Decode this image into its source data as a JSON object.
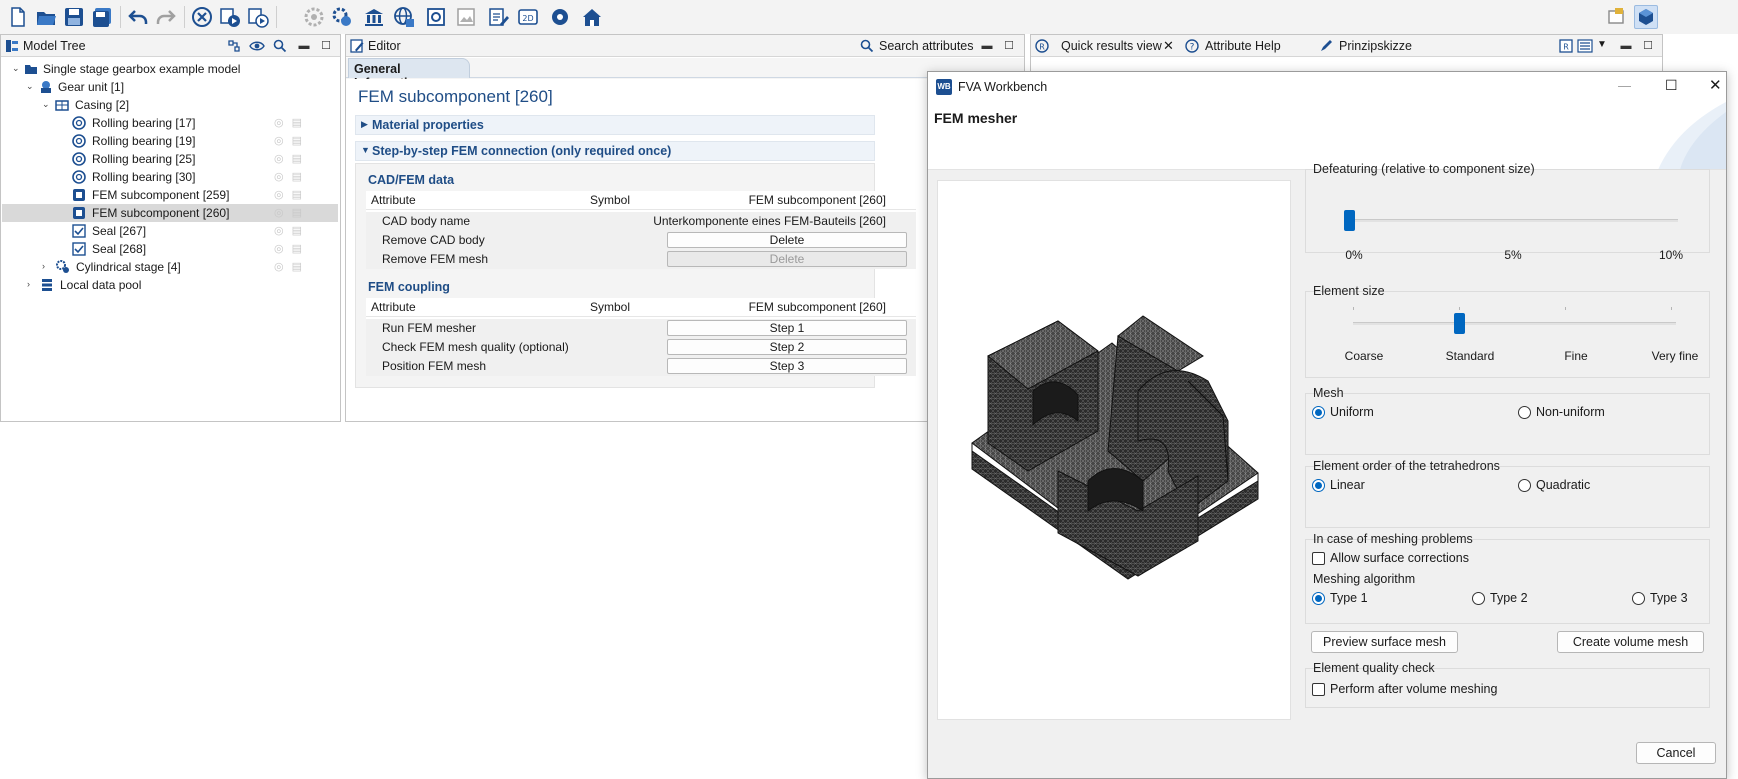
{
  "colors": {
    "accent": "#0067c0",
    "section_text": "#1f4d86",
    "pane_header": "#f3f3f3",
    "selected_row": "#d9d9d9"
  },
  "toolbar": {
    "icons": [
      "new-document-icon",
      "open-folder-icon",
      "save-icon",
      "save-all-icon",
      "undo-icon",
      "redo-icon",
      "stop-calculation-icon",
      "run-calculation-icon",
      "run-step-icon",
      "gear-disabled-icon",
      "gear-settings-icon",
      "library-icon",
      "globe-icon",
      "component-icon",
      "image-icon",
      "report-edit-icon",
      "view-2d-icon",
      "settings-gear-icon",
      "home-icon"
    ],
    "right_icons": [
      "perspective-icon",
      "cube-icon"
    ]
  },
  "model_tree": {
    "title": "Model Tree",
    "items": [
      {
        "label": "Single stage gearbox example model",
        "icon": "model-folder-icon"
      },
      {
        "label": "Gear unit [1]",
        "icon": "gear-unit-icon"
      },
      {
        "label": "Casing [2]",
        "icon": "casing-icon"
      },
      {
        "label": "Rolling bearing [17]",
        "icon": "bearing-icon"
      },
      {
        "label": "Rolling bearing [19]",
        "icon": "bearing-icon"
      },
      {
        "label": "Rolling bearing [25]",
        "icon": "bearing-icon"
      },
      {
        "label": "Rolling bearing [30]",
        "icon": "bearing-icon"
      },
      {
        "label": "FEM subcomponent [259]",
        "icon": "fem-subcomponent-icon"
      },
      {
        "label": "FEM subcomponent [260]",
        "icon": "fem-subcomponent-icon"
      },
      {
        "label": "Seal [267]",
        "icon": "seal-checkbox-icon"
      },
      {
        "label": "Seal [268]",
        "icon": "seal-checkbox-icon"
      },
      {
        "label": "Cylindrical stage [4]",
        "icon": "cylindrical-stage-icon"
      },
      {
        "label": "Local data pool",
        "icon": "data-pool-icon"
      }
    ]
  },
  "editor": {
    "tab_title": "Editor",
    "search_label": "Search attributes",
    "sub_tab": "General Information",
    "heading": "FEM subcomponent [260]",
    "sections": {
      "material": "Material properties",
      "fem_connection": "Step-by-step FEM connection (only required once)"
    },
    "cad_fem": {
      "title": "CAD/FEM data",
      "columns": [
        "Attribute",
        "Symbol",
        "FEM subcomponent [260]"
      ],
      "rows": [
        {
          "attribute": "CAD body name",
          "value": "Unterkomponente eines FEM-Bauteils [260]"
        },
        {
          "attribute": "Remove CAD body",
          "value": "Delete"
        },
        {
          "attribute": "Remove FEM mesh",
          "value": "Delete"
        }
      ]
    },
    "fem_coupling": {
      "title": "FEM coupling",
      "columns": [
        "Attribute",
        "Symbol",
        "FEM subcomponent [260]"
      ],
      "rows": [
        {
          "attribute": "Run FEM mesher",
          "value": "Step 1"
        },
        {
          "attribute": "Check FEM mesh quality (optional)",
          "value": "Step 2"
        },
        {
          "attribute": "Position FEM mesh",
          "value": "Step 3"
        }
      ]
    }
  },
  "right_pane": {
    "tabs": [
      "Quick results view",
      "Attribute Help",
      "Prinzipskizze"
    ]
  },
  "dialog": {
    "app_title": "FVA Workbench",
    "logo_text": "WB",
    "header": "FEM mesher",
    "defeaturing": {
      "title": "Defeaturing (relative to component size)",
      "ticks": [
        "0%",
        "5%",
        "10%"
      ],
      "value_percent": 0
    },
    "element_size": {
      "title": "Element size",
      "ticks": [
        "Coarse",
        "Standard",
        "Fine",
        "Very fine"
      ],
      "selected_index": 1
    },
    "mesh": {
      "title": "Mesh",
      "options": [
        "Uniform",
        "Non-uniform"
      ],
      "selected": "Uniform"
    },
    "element_order": {
      "title": "Element order of the tetrahedrons",
      "options": [
        "Linear",
        "Quadratic"
      ],
      "selected": "Linear"
    },
    "meshing_problems": {
      "title": "In case of meshing problems",
      "allow_surface_corrections": "Allow surface corrections",
      "allow_checked": false,
      "algorithm_label": "Meshing algorithm",
      "algorithms": [
        "Type 1",
        "Type 2",
        "Type 3"
      ],
      "selected": "Type 1"
    },
    "buttons": {
      "preview": "Preview surface mesh",
      "create": "Create volume mesh",
      "cancel": "Cancel"
    },
    "quality_check": {
      "title": "Element quality check",
      "perform_after": "Perform after volume meshing",
      "checked": false
    }
  }
}
